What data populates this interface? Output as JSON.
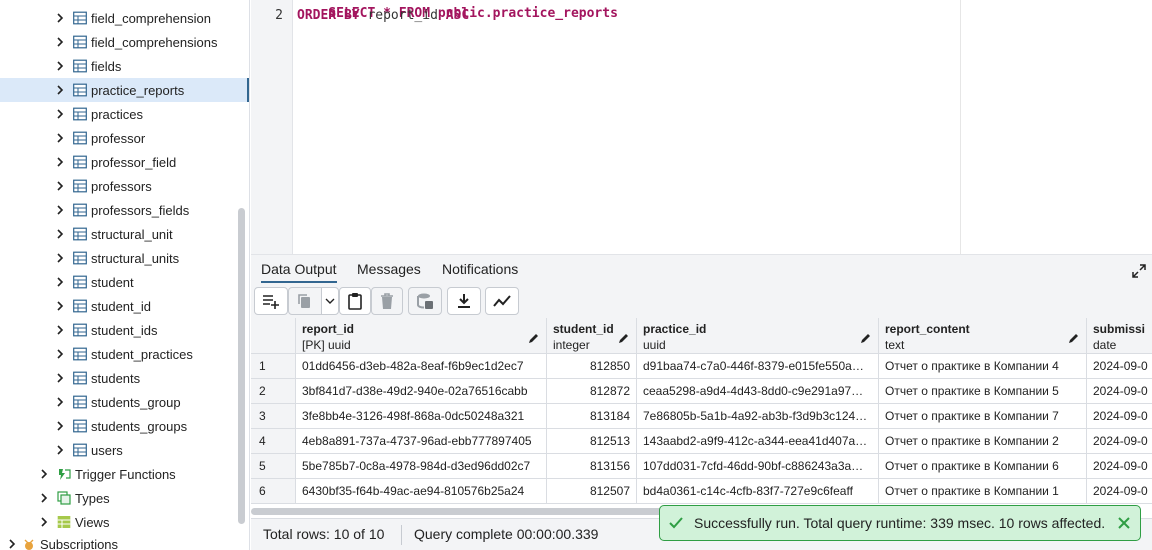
{
  "sidebar": {
    "tables": [
      "field_comprehension",
      "field_comprehensions",
      "fields",
      "practice_reports",
      "practices",
      "professor",
      "professor_field",
      "professors",
      "professors_fields",
      "structural_unit",
      "structural_units",
      "student",
      "student_id",
      "student_ids",
      "student_practices",
      "students",
      "students_group",
      "students_groups",
      "users"
    ],
    "selected_table": "practice_reports",
    "groups": [
      "Trigger Functions",
      "Types",
      "Views"
    ],
    "bottom_item": "Subscriptions"
  },
  "editor": {
    "line_numbers": [
      "2"
    ],
    "line1_partial": "SELECT * FROM public.practice_reports",
    "line2_kw1": "ORDER BY",
    "line2_col": "report_id",
    "line2_kw2": "ASC"
  },
  "tabs": {
    "data_output": "Data Output",
    "messages": "Messages",
    "notifications": "Notifications",
    "active": "Data Output"
  },
  "grid": {
    "columns": [
      {
        "name": "report_id",
        "type": "[PK] uuid"
      },
      {
        "name": "student_id",
        "type": "integer"
      },
      {
        "name": "practice_id",
        "type": "uuid"
      },
      {
        "name": "report_content",
        "type": "text"
      },
      {
        "name": "submissi",
        "type": "date"
      }
    ],
    "rows": [
      {
        "n": "1",
        "report_id": "01dd6456-d3eb-482a-8eaf-f6b9ec1d2ec7",
        "student_id": "812850",
        "practice_id": "d91baa74-c7a0-446f-8379-e015fe550a…",
        "report_content": "Отчет о практике в Компании 4",
        "date": "2024-09-0"
      },
      {
        "n": "2",
        "report_id": "3bf841d7-d38e-49d2-940e-02a76516cabb",
        "student_id": "812872",
        "practice_id": "ceaa5298-a9d4-4d43-8dd0-c9e291a97…",
        "report_content": "Отчет о практике в Компании 5",
        "date": "2024-09-0"
      },
      {
        "n": "3",
        "report_id": "3fe8bb4e-3126-498f-868a-0dc50248a321",
        "student_id": "813184",
        "practice_id": "7e86805b-5a1b-4a92-ab3b-f3d9b3c124…",
        "report_content": "Отчет о практике в Компании 7",
        "date": "2024-09-0"
      },
      {
        "n": "4",
        "report_id": "4eb8a891-737a-4737-96ad-ebb777897405",
        "student_id": "812513",
        "practice_id": "143aabd2-a9f9-412c-a344-eea41d407a…",
        "report_content": "Отчет о практике в Компании 2",
        "date": "2024-09-0"
      },
      {
        "n": "5",
        "report_id": "5be785b7-0c8a-4978-984d-d3ed96dd02c7",
        "student_id": "813156",
        "practice_id": "107dd031-7cfd-46dd-90bf-c886243a3a…",
        "report_content": "Отчет о практике в Компании 6",
        "date": "2024-09-0"
      },
      {
        "n": "6",
        "report_id": "6430bf35-f64b-49ac-ae94-810576b25a24",
        "student_id": "812507",
        "practice_id": "bd4a0361-c14c-4cfb-83f7-727e9c6feaff",
        "report_content": "Отчет о практике в Компании 1",
        "date": "2024-09-0"
      }
    ]
  },
  "status": {
    "total_rows": "Total rows: 10 of 10",
    "query_complete": "Query complete 00:00:00.339"
  },
  "toast": {
    "message": "Successfully run. Total query runtime: 339 msec. 10 rows affected."
  },
  "colors": {
    "accent": "#326690",
    "selected_bg": "#dbe9f9",
    "keyword": "#a3155e",
    "toast_bg": "#d1f2d9",
    "toast_border": "#2f9e44"
  }
}
